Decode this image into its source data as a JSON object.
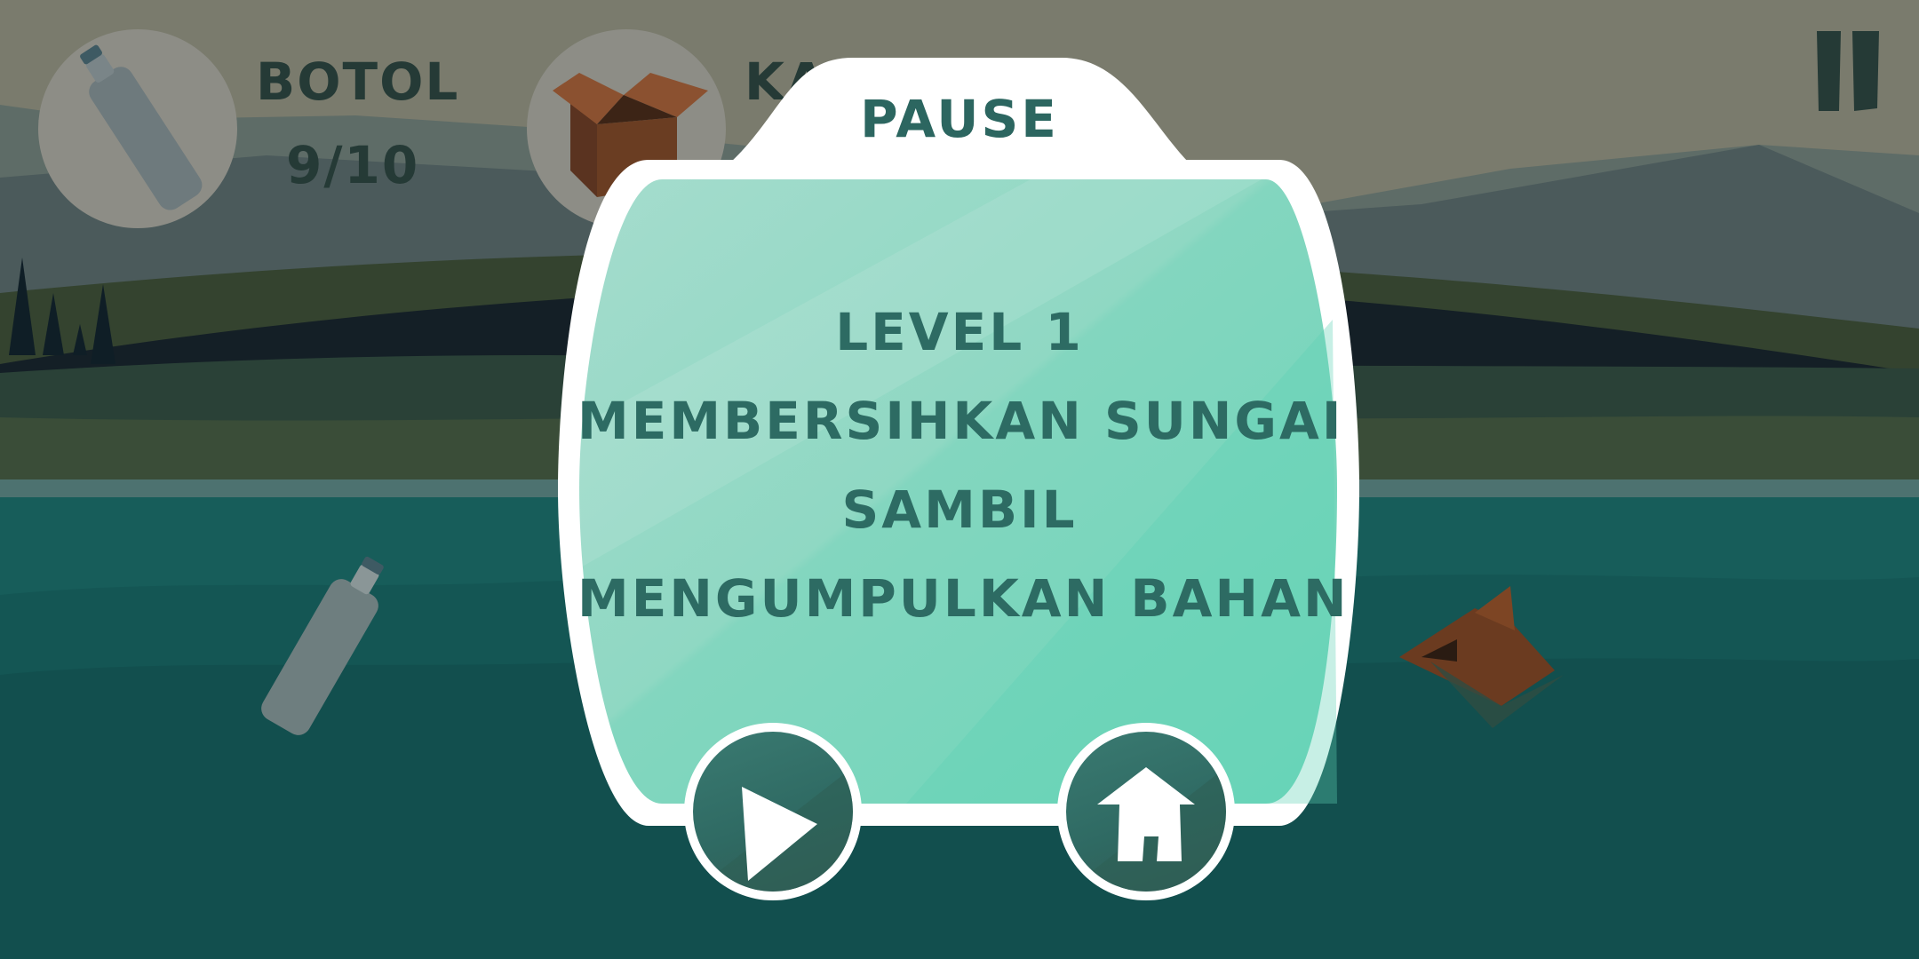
{
  "hud": {
    "bottle_label": "BOTOL",
    "bottle_count": "9/10",
    "box_label_partial": "KA",
    "bottle_icon": "bottle-icon",
    "box_icon": "cardboard-box-icon",
    "pause_icon": "pause-icon"
  },
  "pause_menu": {
    "title": "PAUSE",
    "lines": [
      "LEVEL 1",
      "MEMBERSIHKAN SUNGAI",
      "SAMBIL",
      "MENGUMPULKAN BAHAN"
    ],
    "resume_icon": "play-icon",
    "home_icon": "home-icon"
  },
  "colors": {
    "sky": "#7a7b6d",
    "river": "#155a58",
    "panel": "#7fd7c0",
    "text": "#2d6b63",
    "hud_text": "#253a36",
    "button": "#2f6a63"
  }
}
